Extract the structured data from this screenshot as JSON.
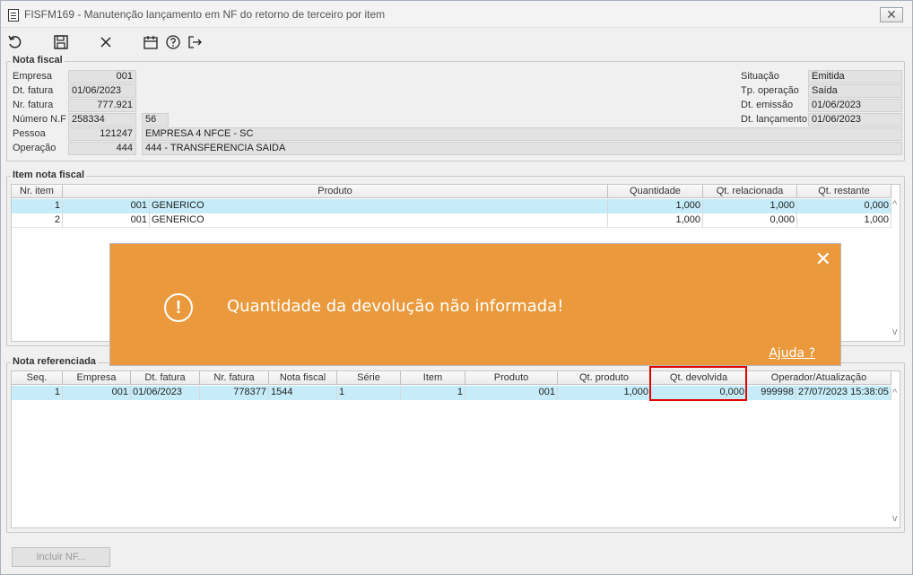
{
  "window": {
    "title": "FISFM169 - Manutenção lançamento em NF do retorno de terceiro por item",
    "close_symbol": "✕"
  },
  "toolbar": {
    "items": [
      {
        "name": "undo-icon"
      },
      {
        "name": "save-icon"
      },
      {
        "name": "cancel-icon"
      },
      {
        "name": "calendar-icon"
      },
      {
        "name": "help-icon"
      },
      {
        "name": "exit-icon"
      }
    ]
  },
  "nota_fiscal": {
    "title": "Nota fiscal",
    "empresa_label": "Empresa",
    "empresa": "001",
    "dt_fatura_label": "Dt. fatura",
    "dt_fatura": "01/06/2023",
    "nr_fatura_label": "Nr. fatura",
    "nr_fatura": "777.921",
    "numero_nf_label": "Número N.F",
    "numero_nf": "258334",
    "serie": "56",
    "pessoa_label": "Pessoa",
    "pessoa_code": "121247",
    "pessoa_name": "EMPRESA 4 NFCE - SC",
    "operacao_label": "Operação",
    "operacao_code": "444",
    "operacao_name": "444 - TRANSFERENCIA SAIDA",
    "situacao_label": "Situação",
    "situacao": "Emitida",
    "tp_operacao_label": "Tp. operação",
    "tp_operacao": "Saída",
    "dt_emissao_label": "Dt. emissão",
    "dt_emissao": "01/06/2023",
    "dt_lancamento_label": "Dt. lançamento",
    "dt_lancamento": "01/06/2023"
  },
  "item_nota": {
    "title": "Item nota fiscal",
    "headers": [
      "Nr. item",
      "Produto",
      "Quantidade",
      "Qt. relacionada",
      "Qt. restante"
    ],
    "rows": [
      {
        "nr": "1",
        "produto_code": "001",
        "produto_name": "GENERICO",
        "quantidade": "1,000",
        "qt_relacionada": "1,000",
        "qt_restante": "0,000"
      },
      {
        "nr": "2",
        "produto_code": "001",
        "produto_name": "GENERICO",
        "quantidade": "1,000",
        "qt_relacionada": "0,000",
        "qt_restante": "1,000"
      }
    ]
  },
  "nota_ref": {
    "title": "Nota referenciada",
    "headers": [
      "Seq.",
      "Empresa",
      "Dt. fatura",
      "Nr. fatura",
      "Nota fiscal",
      "Série",
      "Item",
      "Produto",
      "Qt. produto",
      "Qt. devolvida",
      "Operador/Atualização"
    ],
    "rows": [
      {
        "seq": "1",
        "empresa": "001",
        "dt_fatura": "01/06/2023",
        "nr_fatura": "778377",
        "nota_fiscal": "1544",
        "serie": "1",
        "item": "1",
        "produto": "001",
        "qt_produto": "1,000",
        "qt_devolvida": "0,000",
        "operador": "999998",
        "atualizacao": "27/07/2023 15:38:05"
      }
    ]
  },
  "toast": {
    "message": "Quantidade da devolução não informada!",
    "help": "Ajuda ?",
    "icon_text": "!",
    "close_symbol": "✕",
    "color": "#ea9a3c"
  },
  "buttons": {
    "incluir_nf": "Incluir NF..."
  },
  "scroll": {
    "up": "^",
    "down": "v"
  }
}
